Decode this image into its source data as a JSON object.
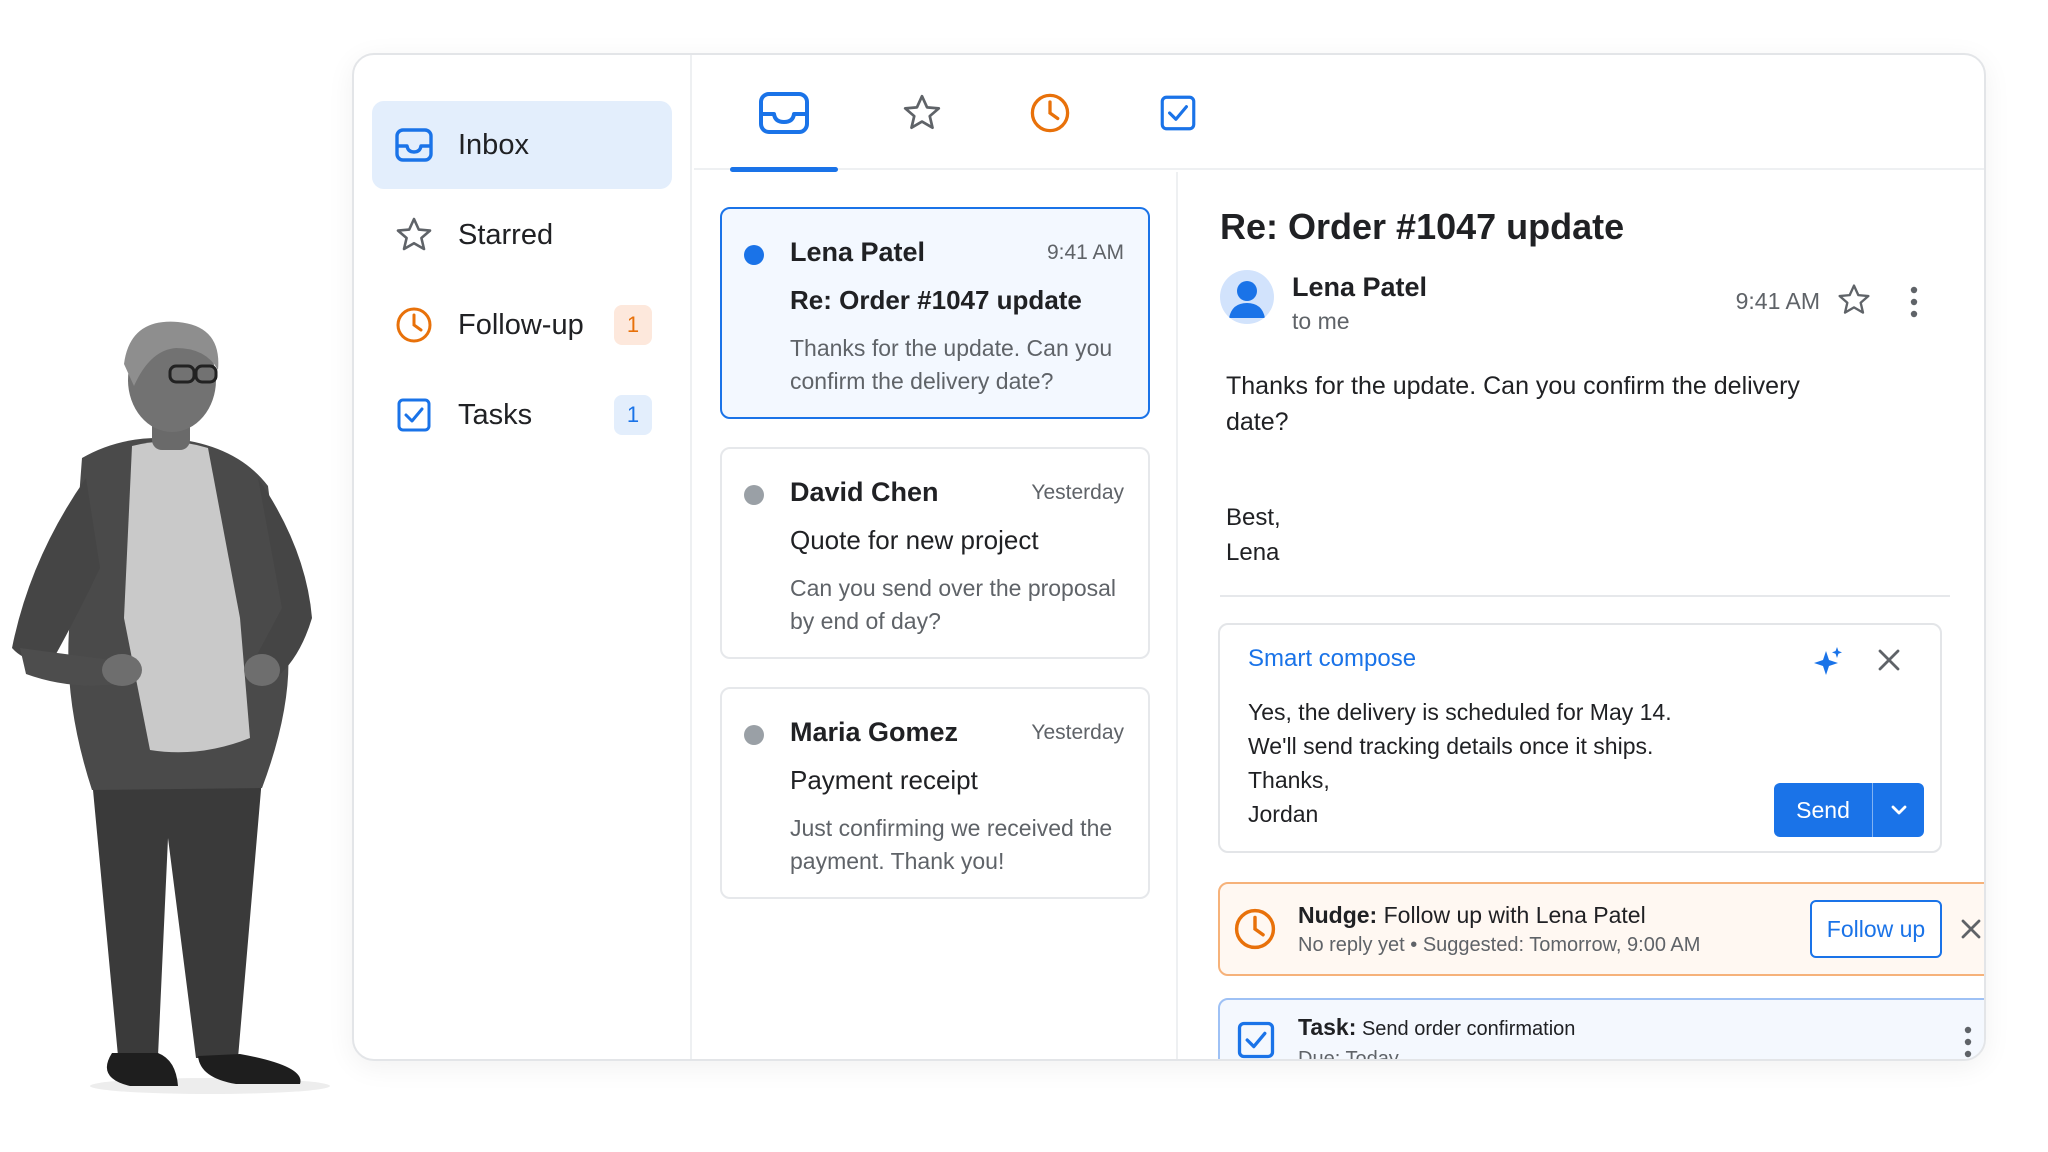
{
  "sidebar": {
    "items": [
      {
        "label": "Inbox",
        "icon": "inbox-icon",
        "badge": ""
      },
      {
        "label": "Starred",
        "icon": "star-icon",
        "badge": ""
      },
      {
        "label": "Follow-up",
        "icon": "clock-icon",
        "badge": "1"
      },
      {
        "label": "Tasks",
        "icon": "checkbox-icon",
        "badge": "1"
      }
    ]
  },
  "tabs": [
    {
      "icon": "inbox-icon",
      "active": true
    },
    {
      "icon": "star-icon",
      "active": false
    },
    {
      "icon": "clock-icon",
      "active": false
    },
    {
      "icon": "checkbox-icon",
      "active": false
    }
  ],
  "messages": [
    {
      "sender": "Lena Patel",
      "time": "9:41 AM",
      "subject": "Re: Order #1047 update",
      "preview": "Thanks for the update. Can you confirm the delivery date?",
      "unread": true
    },
    {
      "sender": "David Chen",
      "time": "Yesterday",
      "subject": "Quote for new project",
      "preview": "Can you send over the proposal by end of day?",
      "unread": false
    },
    {
      "sender": "Maria Gomez",
      "time": "Yesterday",
      "subject": "Payment receipt",
      "preview": "Just confirming we received the payment. Thank you!",
      "unread": false
    }
  ],
  "reader": {
    "subject": "Re: Order #1047 update",
    "sender": "Lena Patel",
    "to": "to me",
    "time": "9:41 AM",
    "body": "Thanks for the update. Can you confirm the delivery date?",
    "sign_off": "Best,",
    "sign_name": "Lena"
  },
  "compose": {
    "title": "Smart compose",
    "lines": [
      "Yes, the delivery is scheduled for May 14.",
      "We'll send tracking details once it ships.",
      "Thanks,",
      "Jordan"
    ],
    "send_label": "Send"
  },
  "nudge": {
    "title_bold": "Nudge:",
    "title_rest": " Follow up with Lena Patel",
    "subtitle": "No reply yet • Suggested: Tomorrow, 9:00 AM",
    "button_label": "Follow up"
  },
  "task": {
    "title_bold": "Task:",
    "title_rest": " Send order confirmation",
    "due": "Due: Today"
  },
  "colors": {
    "accent": "#1a73e8",
    "followup": "#e8710a",
    "selected_bg": "#e3eefc"
  }
}
